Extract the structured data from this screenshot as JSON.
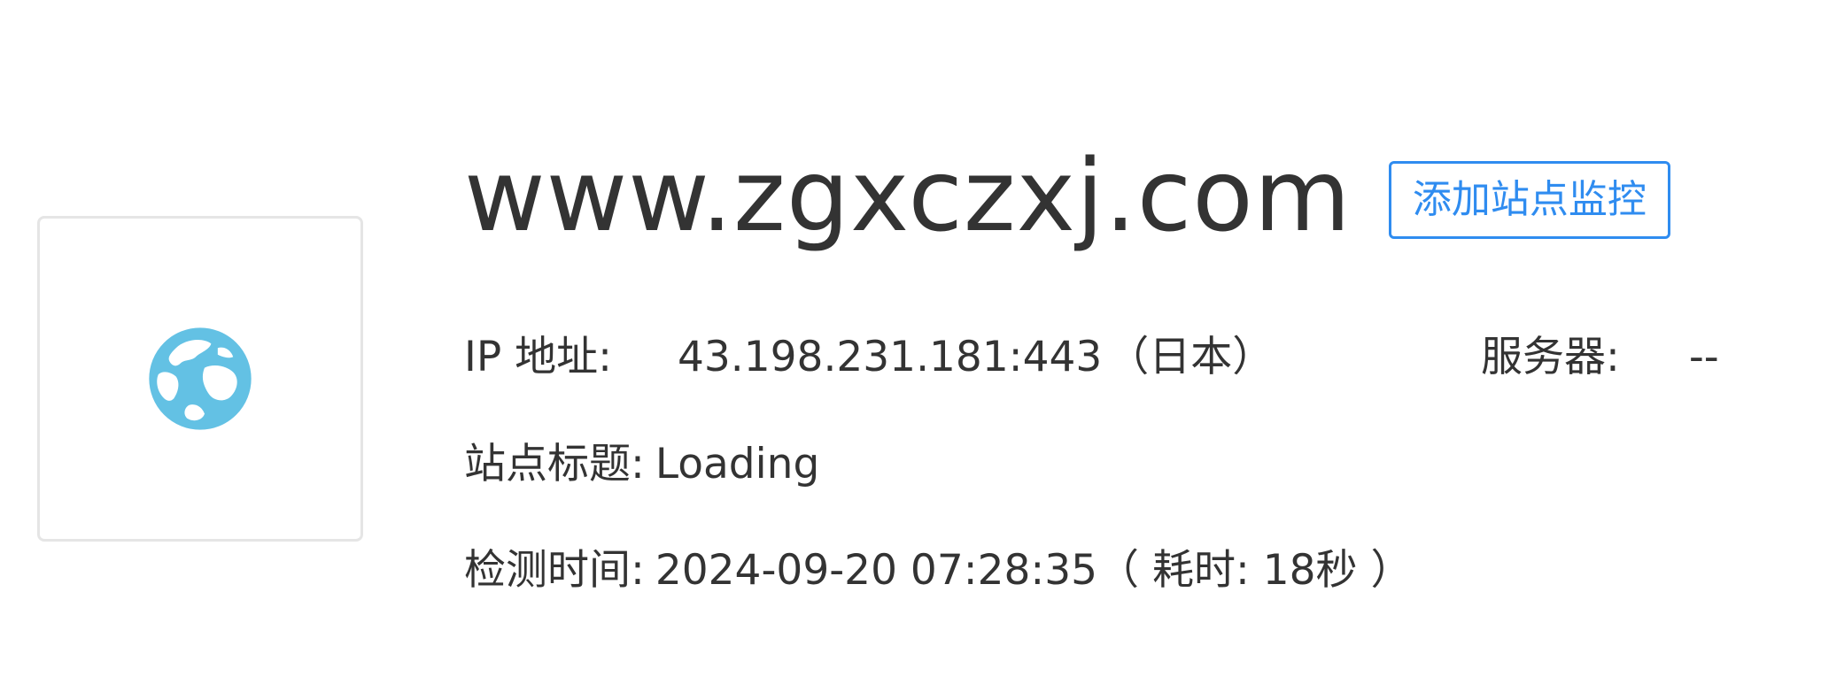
{
  "site": {
    "domain": "www.zgxczxj.com",
    "monitor_button_label": "添加站点监控"
  },
  "info": {
    "ip_label": "IP 地址:",
    "ip_value": "43.198.231.181:443",
    "ip_region": "（日本）",
    "server_label": "服务器:",
    "server_value": "--",
    "title_label": "站点标题:",
    "title_value": "Loading",
    "time_label": "检测时间:",
    "time_value": "2024-09-20 07:28:35（ 耗时: 18秒 ）"
  },
  "icons": {
    "thumbnail": "globe-icon"
  },
  "colors": {
    "accent": "#2f8cf0",
    "globe": "#63c1e4",
    "text": "#333333",
    "card_border": "#e5e5e5"
  }
}
